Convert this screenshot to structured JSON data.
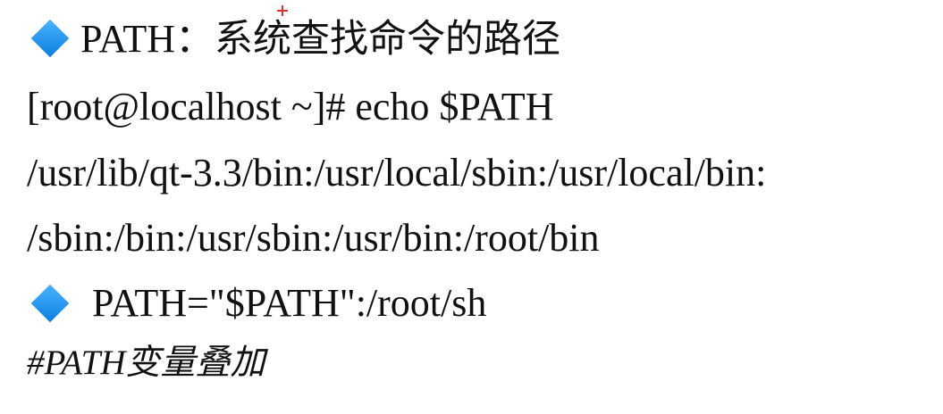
{
  "heading": {
    "keyword": "PATH：",
    "description": "系统查找命令的路径"
  },
  "command_line": "[root@localhost ~]# echo $PATH",
  "output_line1": "/usr/lib/qt-3.3/bin:/usr/local/sbin:/usr/local/bin:",
  "output_line2": "/sbin:/bin:/usr/sbin:/usr/bin:/root/bin",
  "assignment": "PATH=\"$PATH\":/root/sh",
  "comment": "#PATH变量叠加",
  "colors": {
    "bullet": "#1a8cf0",
    "cursor": "#e23030",
    "text": "#111111"
  }
}
